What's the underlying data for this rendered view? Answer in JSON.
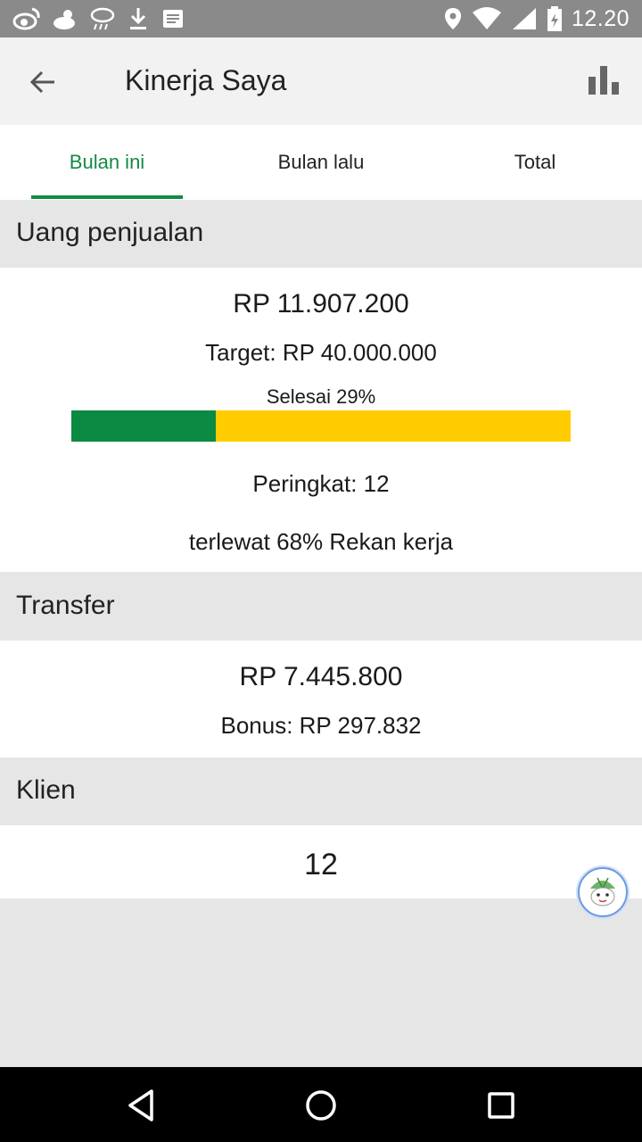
{
  "status_bar": {
    "time": "12.20",
    "icons": [
      "weibo-icon",
      "cloud-sun-icon",
      "rain-icon",
      "download-icon",
      "message-icon",
      "location-icon",
      "wifi-icon",
      "signal-icon",
      "battery-icon"
    ]
  },
  "app_bar": {
    "title": "Kinerja Saya",
    "back_icon": "arrow-left-icon",
    "chart_icon": "bar-chart-icon"
  },
  "tabs": [
    {
      "label": "Bulan ini",
      "active": true
    },
    {
      "label": "Bulan lalu",
      "active": false
    },
    {
      "label": "Total",
      "active": false
    }
  ],
  "sales": {
    "header": "Uang penjualan",
    "amount": "RP 11.907.200",
    "target": "Target: RP 40.000.000",
    "progress_label": "Selesai 29%",
    "progress_fraction": 0.29,
    "rank": "Peringkat: 12",
    "surpassed": "terlewat 68% Rekan kerja"
  },
  "transfer": {
    "header": "Transfer",
    "amount": "RP 7.445.800",
    "bonus": "Bonus: RP 297.832"
  },
  "clients": {
    "header": "Klien",
    "count": "12"
  },
  "colors": {
    "accent": "#138a45",
    "progress_done": "#0b8a43",
    "progress_remaining": "#ffcc00",
    "status_bar": "#8a8a8a",
    "section_header": "#e6e6e6"
  },
  "nav_bar": {
    "icons": [
      "back-triangle-icon",
      "home-circle-icon",
      "recents-square-icon"
    ]
  }
}
